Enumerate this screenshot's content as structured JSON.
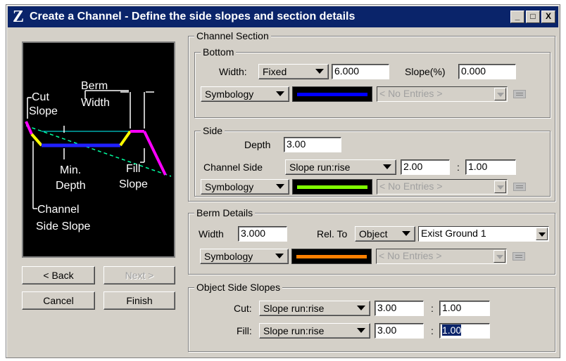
{
  "window": {
    "title": "Create a Channel - Define the side slopes and section details",
    "buttons": {
      "minimize": "_",
      "maximize": "□",
      "close": "X"
    },
    "icon": "Z"
  },
  "preview": {
    "labels": {
      "cut_slope_1": "Cut",
      "cut_slope_2": "Slope",
      "berm_width_1": "Berm",
      "berm_width_2": "Width",
      "min_depth_1": "Min.",
      "min_depth_2": "Depth",
      "fill_slope_1": "Fill",
      "fill_slope_2": "Slope",
      "channel_side_1": "Channel",
      "channel_side_2": "Side Slope"
    },
    "colors": {
      "bottom": "#2020ff",
      "side": "#ffff00",
      "berm": "#ff00ff",
      "ground": "#00ffa0",
      "outline": "#ffffff"
    }
  },
  "nav": {
    "back": "< Back",
    "next": "Next >",
    "cancel": "Cancel",
    "finish": "Finish"
  },
  "channel_section": {
    "label": "Channel Section",
    "bottom": {
      "label": "Bottom",
      "width_label": "Width:",
      "width_mode": "Fixed",
      "width_value": "6.000",
      "slope_label": "Slope(%)",
      "slope_value": "0.000",
      "symbology": "Symbology",
      "symbology_color": "#0000ff",
      "entries": "< No Entries >"
    },
    "side": {
      "label": "Side",
      "depth_label": "Depth",
      "depth_value": "3.00",
      "channel_side_label": "Channel Side",
      "channel_side_mode": "Slope run:rise",
      "run": "2.00",
      "ratio_sep": ":",
      "rise": "1.00",
      "symbology": "Symbology",
      "symbology_color": "#80ff00",
      "entries": "< No Entries >"
    }
  },
  "berm": {
    "label": "Berm Details",
    "width_label": "Width",
    "width_value": "3.000",
    "rel_to_label": "Rel. To",
    "rel_to_mode": "Object",
    "object": "Exist Ground 1",
    "symbology": "Symbology",
    "symbology_color": "#ff8000",
    "entries": "< No Entries >"
  },
  "object_side_slopes": {
    "label": "Object Side Slopes",
    "cut_label": "Cut:",
    "cut_mode": "Slope run:rise",
    "cut_run": "3.00",
    "cut_sep": ":",
    "cut_rise": "1.00",
    "fill_label": "Fill:",
    "fill_mode": "Slope run:rise",
    "fill_run": "3.00",
    "fill_sep": ":",
    "fill_rise": "1.00"
  }
}
